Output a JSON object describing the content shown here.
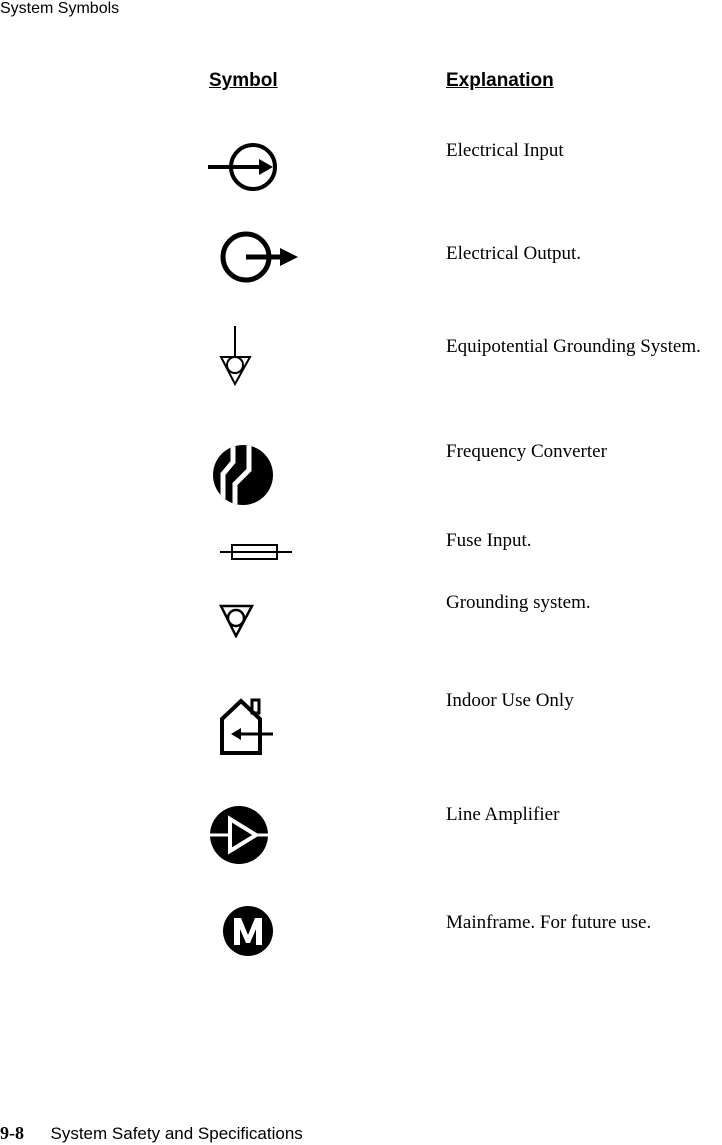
{
  "header": {
    "running_title": "System Symbols"
  },
  "table": {
    "columns": {
      "symbol": "Symbol",
      "explanation": "Explanation"
    },
    "rows": [
      {
        "icon": "electrical-input-icon",
        "explanation": "Electrical Input"
      },
      {
        "icon": "electrical-output-icon",
        "explanation": "Electrical Output."
      },
      {
        "icon": "equipotential-grounding-icon",
        "explanation": "Equipotential Grounding System."
      },
      {
        "icon": "frequency-converter-icon",
        "explanation": "Frequency Converter"
      },
      {
        "icon": "fuse-input-icon",
        "explanation": "Fuse Input."
      },
      {
        "icon": "grounding-system-icon",
        "explanation": "Grounding system."
      },
      {
        "icon": "indoor-use-only-icon",
        "explanation": "Indoor Use Only"
      },
      {
        "icon": "line-amplifier-icon",
        "explanation": "Line Amplifier"
      },
      {
        "icon": "mainframe-icon",
        "explanation": "Mainframe. For future use."
      }
    ]
  },
  "footer": {
    "page_number": "9-8",
    "section_title": "System Safety and Specifications"
  }
}
